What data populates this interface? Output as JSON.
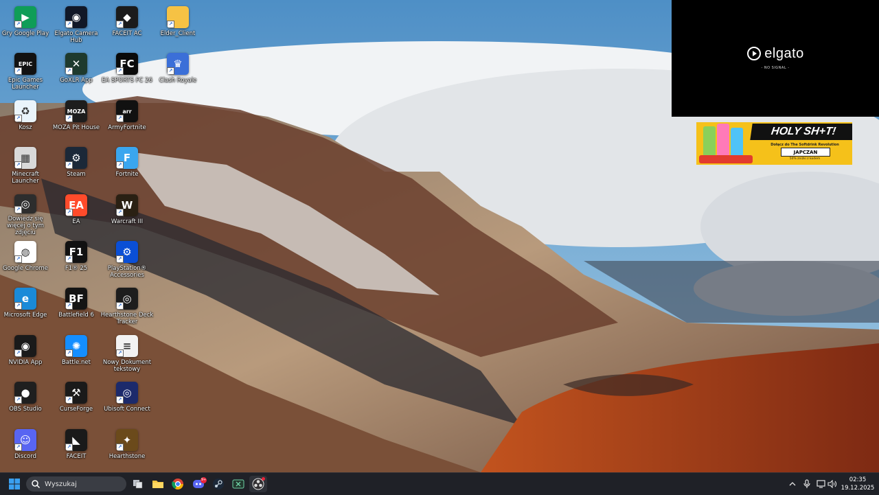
{
  "desktop": {
    "icons": [
      {
        "label": "Gry Google Play",
        "icon": "google-play-games-icon",
        "color": "#0f9d58"
      },
      {
        "label": "Elgato Camera Hub",
        "icon": "elgato-camera-hub-icon",
        "color": "#111827"
      },
      {
        "label": "FACEIT AC",
        "icon": "faceit-ac-icon",
        "color": "#1b1b1b"
      },
      {
        "label": "Elder_Client",
        "icon": "folder-icon",
        "color": "#f6c244"
      },
      {
        "label": "Epic Games Launcher",
        "icon": "epic-games-icon",
        "color": "#121212"
      },
      {
        "label": "GoXLR App",
        "icon": "goxlr-icon",
        "color": "#1e3a2e"
      },
      {
        "label": "EA SPORTS FC 26",
        "icon": "ea-sports-fc-icon",
        "color": "#0a0a0a"
      },
      {
        "label": "Clash Royale",
        "icon": "clash-royale-icon",
        "color": "#3b6fd8"
      },
      {
        "label": "Kosz",
        "icon": "recycle-bin-icon",
        "color": "#eaf4fb"
      },
      {
        "label": "MOZA Pit House",
        "icon": "moza-icon",
        "color": "#1d1d1d"
      },
      {
        "label": "ArmyFortnite",
        "icon": "army-fortnite-icon",
        "color": "#111"
      },
      {
        "label": "Minecraft Launcher",
        "icon": "minecraft-icon",
        "color": "#d9d9d9"
      },
      {
        "label": "Steam",
        "icon": "steam-icon",
        "color": "#1b2838"
      },
      {
        "label": "Fortnite",
        "icon": "fortnite-icon",
        "color": "#3aa6ef"
      },
      {
        "label": "Dowiedz się więcej o tym zdjęciu",
        "icon": "camera-info-icon",
        "color": "#2d2d2d"
      },
      {
        "label": "EA",
        "icon": "ea-app-icon",
        "color": "#ff4b2b"
      },
      {
        "label": "Warcraft III",
        "icon": "warcraft-iii-icon",
        "color": "#2a2013"
      },
      {
        "label": "Google Chrome",
        "icon": "chrome-icon",
        "color": "#ffffff"
      },
      {
        "label": "F1® 25",
        "icon": "f1-25-icon",
        "color": "#111"
      },
      {
        "label": "PlayStation® Accessories",
        "icon": "playstation-accessories-icon",
        "color": "#0a4fd6"
      },
      {
        "label": "Microsoft Edge",
        "icon": "edge-icon",
        "color": "#1a8ad8"
      },
      {
        "label": "Battlefield 6",
        "icon": "battlefield-6-icon",
        "color": "#141414"
      },
      {
        "label": "Hearthstone Deck Tracker",
        "icon": "hearthstone-deck-tracker-icon",
        "color": "#1d1d1d"
      },
      {
        "label": "NVIDIA App",
        "icon": "nvidia-icon",
        "color": "#1a1a1a"
      },
      {
        "label": "Battle.net",
        "icon": "battle-net-icon",
        "color": "#148eff"
      },
      {
        "label": "Nowy Dokument tekstowy",
        "icon": "text-document-icon",
        "color": "#f2f2f2"
      },
      {
        "label": "OBS Studio",
        "icon": "obs-icon",
        "color": "#1f1f1f"
      },
      {
        "label": "CurseForge",
        "icon": "curseforge-icon",
        "color": "#1a1a1a"
      },
      {
        "label": "Ubisoft Connect",
        "icon": "ubisoft-connect-icon",
        "color": "#1c2a6b"
      },
      {
        "label": "Discord",
        "icon": "discord-icon",
        "color": "#5865f2"
      },
      {
        "label": "FACEIT",
        "icon": "faceit-icon",
        "color": "#1a1a1a"
      },
      {
        "label": "Hearthstone",
        "icon": "hearthstone-icon",
        "color": "#6b4a1b"
      }
    ]
  },
  "elgato_preview": {
    "brand": "elgato",
    "status": "- NO SIGNAL -"
  },
  "promo": {
    "headline": "HOLY SH+T!",
    "subtitle": "Dołącz do The Softdrink Revolution",
    "button": "JAPCZAN",
    "fine_print": "50% zniżki z kodem"
  },
  "taskbar": {
    "search_placeholder": "Wyszukaj",
    "pinned": [
      {
        "name": "task-view",
        "icon": "task-view-icon"
      },
      {
        "name": "file-explorer",
        "icon": "file-explorer-icon"
      },
      {
        "name": "chrome",
        "icon": "chrome-icon"
      },
      {
        "name": "discord",
        "icon": "discord-icon",
        "badge": "9+"
      },
      {
        "name": "steam",
        "icon": "steam-icon"
      },
      {
        "name": "goxlr",
        "icon": "goxlr-icon"
      },
      {
        "name": "obs",
        "icon": "obs-icon"
      }
    ],
    "tray": [
      "chevron-up-icon",
      "microphone-icon",
      "display-icon",
      "speaker-icon"
    ],
    "time": "02:35",
    "date": "19.12.2025"
  },
  "colors": {
    "taskbar_bg": "#1f2127",
    "accent": "#0078d4"
  }
}
